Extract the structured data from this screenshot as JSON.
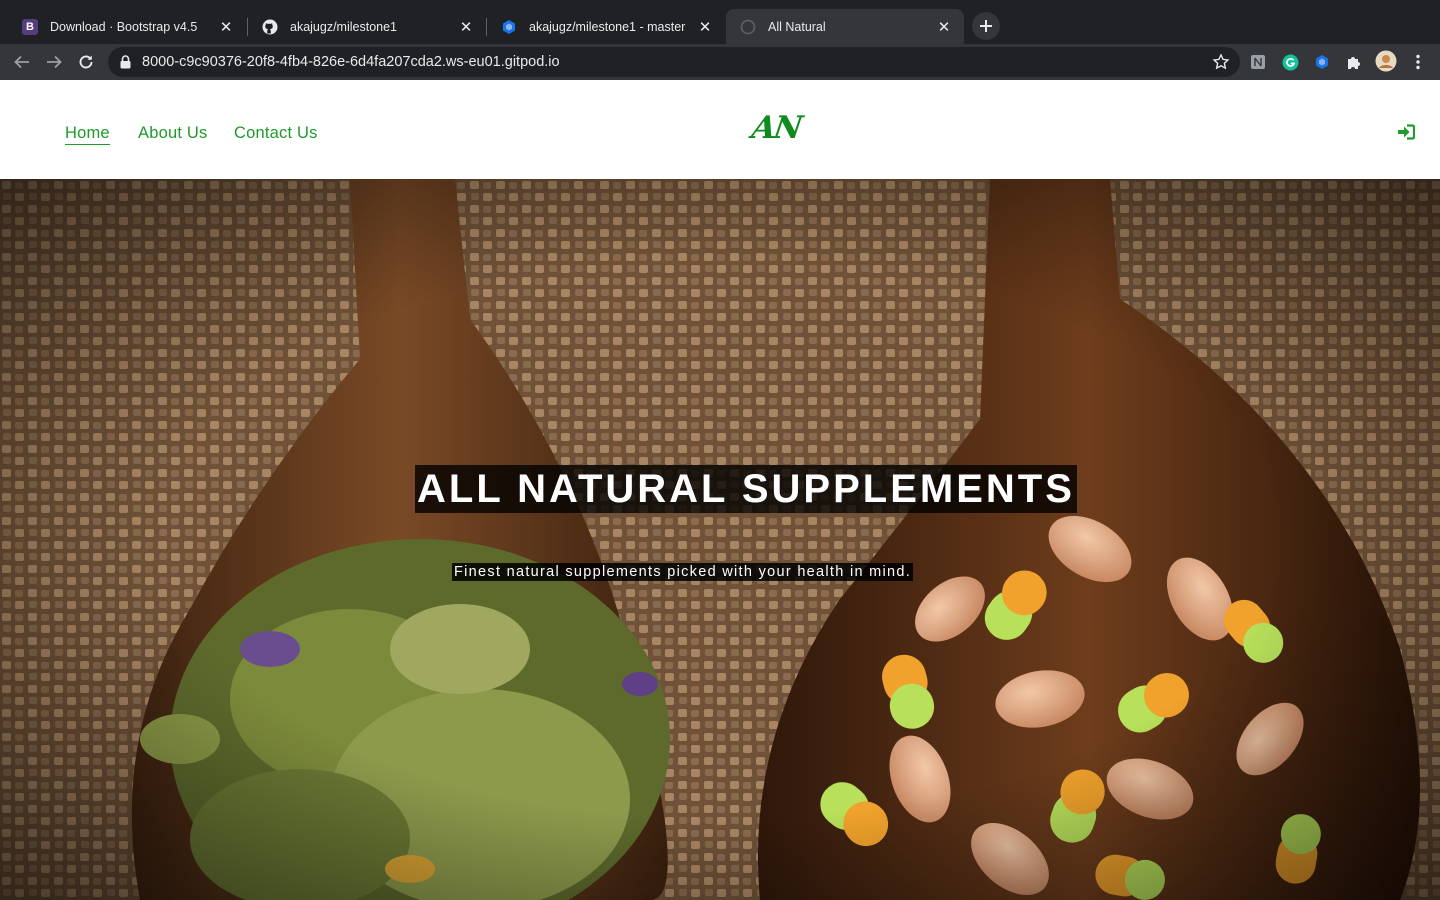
{
  "browser": {
    "tabs": [
      {
        "title": "Download · Bootstrap v4.5",
        "favicon": "bootstrap-icon",
        "favicon_letter": "B",
        "favicon_color": "#563d7c"
      },
      {
        "title": "akajugz/milestone1",
        "favicon": "github-icon"
      },
      {
        "title": "akajugz/milestone1 - master",
        "favicon": "gitpod-icon",
        "favicon_color": "#1a73e8"
      },
      {
        "title": "All Natural",
        "favicon": "globe-icon",
        "active": true
      }
    ],
    "close_glyph": "✕",
    "url": "8000-c9c90376-20f8-4fb4-826e-6d4fa207cda2.ws-eu01.gitpod.io",
    "extensions": [
      "notion-extension-icon",
      "grammarly-extension-icon",
      "gitpod-extension-icon",
      "extensions-puzzle-icon",
      "profile-avatar"
    ]
  },
  "site": {
    "nav": {
      "links": [
        "Home",
        "About Us",
        "Contact Us"
      ],
      "active": "Home",
      "logo": "AN",
      "signin_icon": "sign-in-icon"
    },
    "hero": {
      "title": "ALL NATURAL SUPPLEMENTS",
      "subtitle": "Finest natural supplements picked with your health in mind.",
      "image": "wooden spoons with dried herbs and capsules on burlap"
    }
  },
  "colors": {
    "brand_green": "#1f9a2c",
    "chrome_dark": "#202124",
    "chrome_toolbar": "#35363a"
  }
}
